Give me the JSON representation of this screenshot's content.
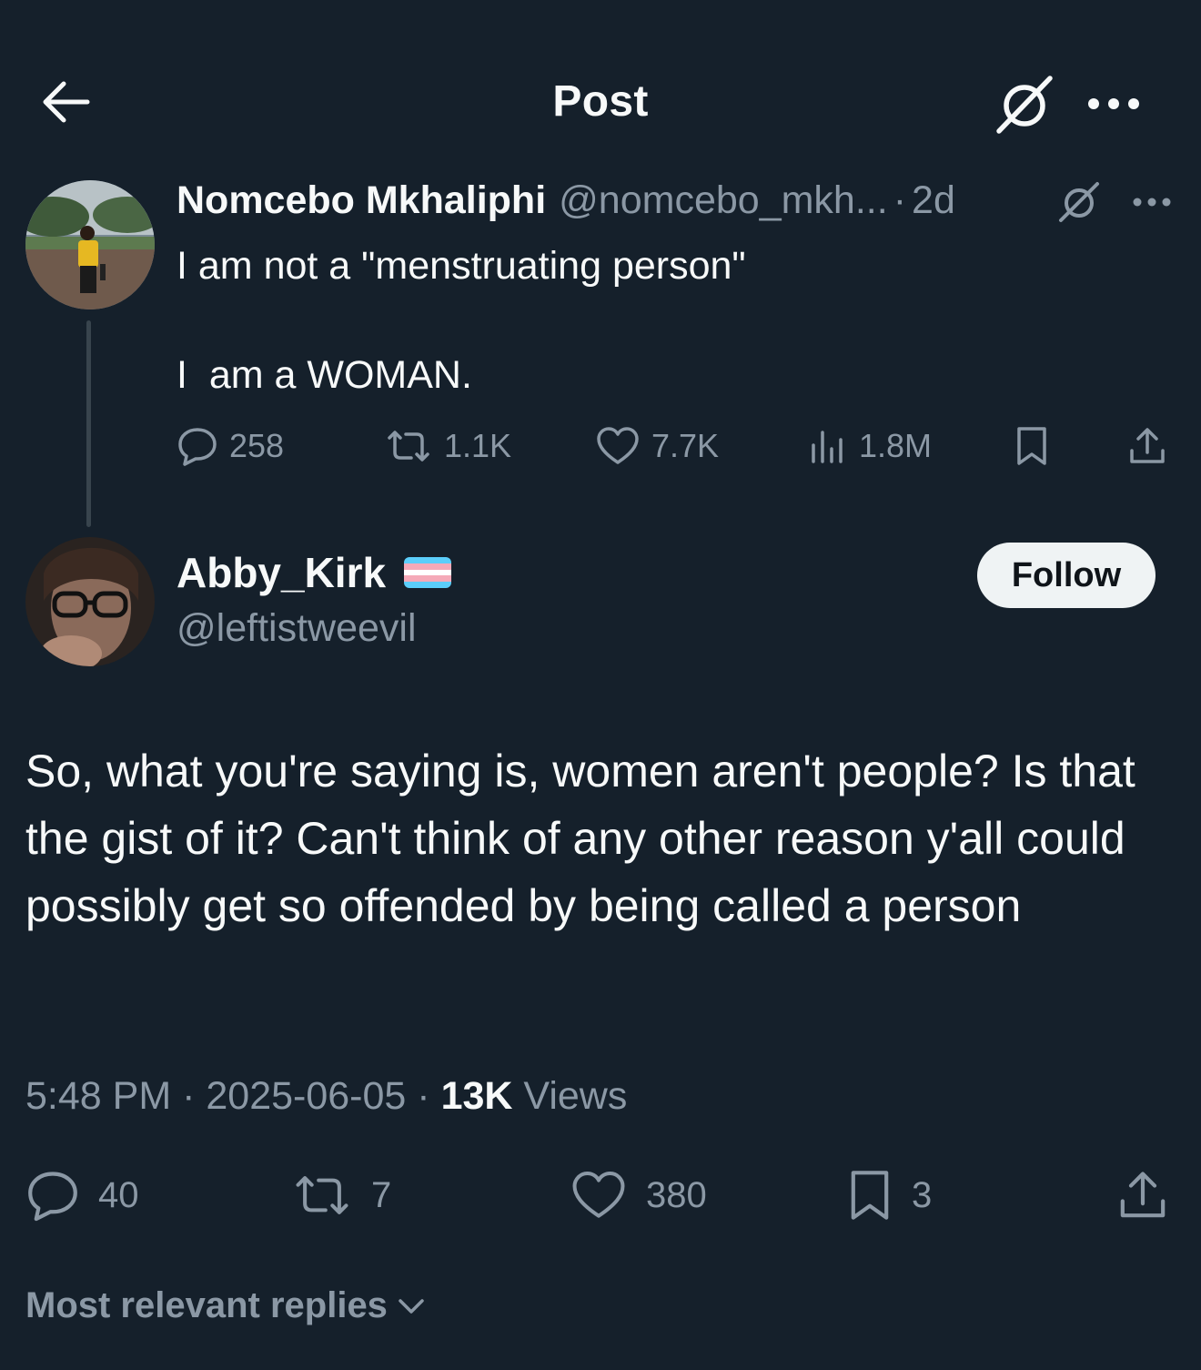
{
  "header": {
    "title": "Post",
    "back_icon": "arrow-left-icon",
    "grok_icon": "grok-icon",
    "more_icon": "more-horizontal-icon"
  },
  "parent_tweet": {
    "name": "Nomcebo Mkhaliphi",
    "handle": "@nomcebo_mkh...",
    "separator": "·",
    "time": "2d",
    "text_line1": "I am not a \"menstruating person\"",
    "text_line2": "I  am a WOMAN.",
    "actions": {
      "replies": "258",
      "reposts": "1.1K",
      "likes": "7.7K",
      "views": "1.8M"
    }
  },
  "main_tweet": {
    "name": "Abby_Kirk",
    "handle": "@leftistweevil",
    "follow_label": "Follow",
    "text": "So, what you're saying is, women aren't people? Is that the gist of it? Can't think of any other reason y'all could possibly get so offended by being called a person",
    "time": "5:48 PM",
    "date": "2025-06-05",
    "views_count": "13K",
    "views_label": "Views",
    "actions": {
      "replies": "40",
      "reposts": "7",
      "likes": "380",
      "bookmarks": "3"
    }
  },
  "replies_sort": {
    "label": "Most relevant replies"
  },
  "colors": {
    "background": "#15202b",
    "text_primary": "#f7f9f9",
    "text_secondary": "#8b98a5",
    "follow_bg": "#eff3f4",
    "thread_line": "#38444d"
  }
}
